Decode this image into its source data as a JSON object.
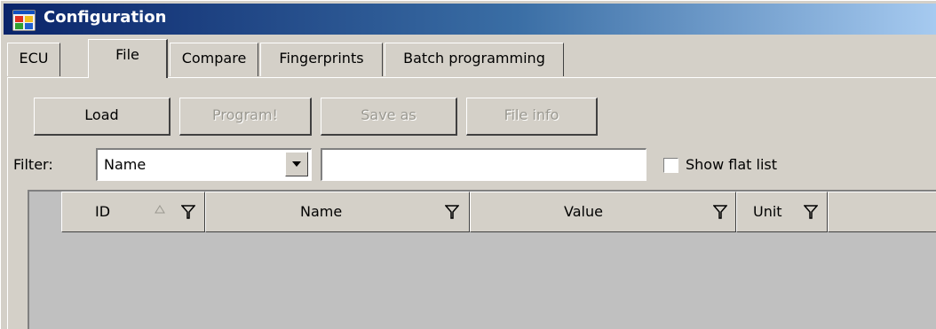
{
  "window": {
    "title": "Configuration",
    "icon": "app-window-icon"
  },
  "tabs": [
    {
      "label": "ECU",
      "active": false
    },
    {
      "label": "File",
      "active": true
    },
    {
      "label": "Compare",
      "active": false
    },
    {
      "label": "Fingerprints",
      "active": false
    },
    {
      "label": "Batch programming",
      "active": false
    }
  ],
  "toolbar": {
    "load_label": "Load",
    "program_label": "Program!",
    "save_as_label": "Save as",
    "file_info_label": "File info"
  },
  "filter": {
    "label": "Filter:",
    "selected": "Name",
    "text_value": "",
    "show_flat_list_label": "Show flat list",
    "show_flat_list_checked": false
  },
  "grid": {
    "columns": [
      {
        "label": "ID",
        "sort": "ascending",
        "filter_icon": "funnel-icon"
      },
      {
        "label": "Name",
        "filter_icon": "funnel-icon"
      },
      {
        "label": "Value",
        "filter_icon": "funnel-icon"
      },
      {
        "label": "Unit",
        "filter_icon": "funnel-icon"
      }
    ],
    "rows": []
  },
  "colors": {
    "title_gradient_start": "#0a246a",
    "title_gradient_end": "#a6caf0",
    "face": "#d4d0c8",
    "grid_background": "#c0c0c0",
    "disabled_text": "#9a9890"
  }
}
